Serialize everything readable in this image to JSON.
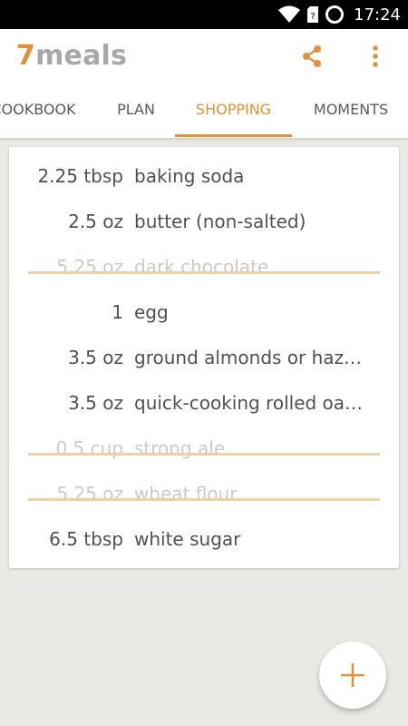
{
  "status_bar": {
    "time": "17:24",
    "icons": [
      "wifi-icon",
      "sim-icon",
      "battery-icon"
    ]
  },
  "app": {
    "title_prefix": "7",
    "title_rest": "meals"
  },
  "tabs": [
    {
      "label": "COOKBOOK",
      "active": false
    },
    {
      "label": "PLAN",
      "active": false
    },
    {
      "label": "SHOPPING",
      "active": true
    },
    {
      "label": "MOMENTS",
      "active": false
    }
  ],
  "shopping_list": [
    {
      "qty": "2.25 tbsp",
      "name": "baking soda",
      "checked": false
    },
    {
      "qty": "2.5 oz",
      "name": "butter (non-salted)",
      "checked": false
    },
    {
      "qty": "5.25 oz",
      "name": "dark chocolate",
      "checked": true
    },
    {
      "qty": "1",
      "name": "egg",
      "checked": false
    },
    {
      "qty": "3.5 oz",
      "name": "ground almonds or haz…",
      "checked": false
    },
    {
      "qty": "3.5 oz",
      "name": "quick-cooking rolled oa…",
      "checked": false
    },
    {
      "qty": "0.5 cup",
      "name": "strong ale",
      "checked": true
    },
    {
      "qty": "5.25 oz",
      "name": "wheat flour",
      "checked": true
    },
    {
      "qty": "6.5 tbsp",
      "name": "white sugar",
      "checked": false
    }
  ],
  "fab": {
    "icon": "plus-icon"
  },
  "colors": {
    "accent": "#e0913a",
    "strike": "#edcfaa",
    "background": "#ebe9e4"
  }
}
